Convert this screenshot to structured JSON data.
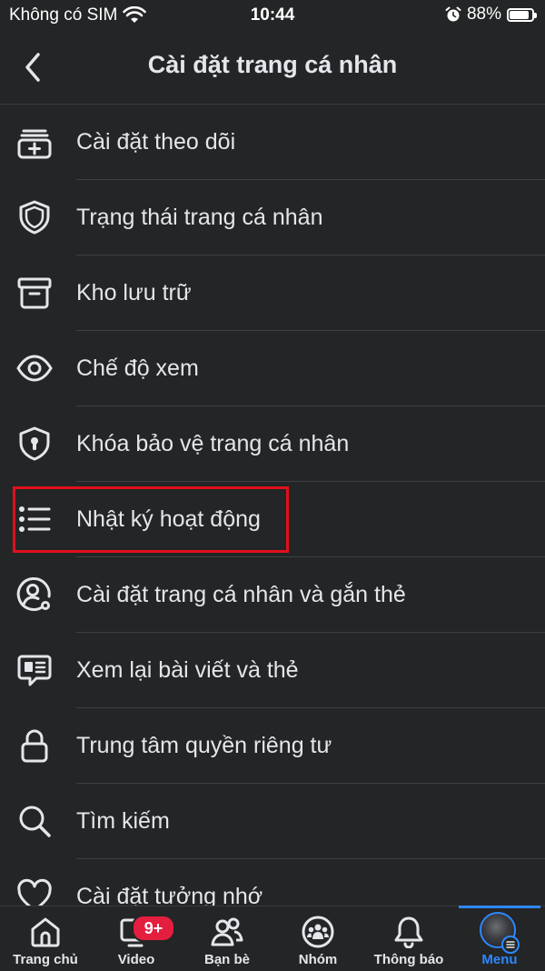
{
  "status_bar": {
    "carrier": "Không có SIM",
    "time": "10:44",
    "battery": "88%",
    "battery_level": 0.88,
    "icons": [
      "wifi-icon",
      "alarm-icon",
      "battery-icon"
    ]
  },
  "header": {
    "title": "Cài đặt trang cá nhân",
    "back_icon": "chevron-left-icon"
  },
  "menu": {
    "items": [
      {
        "label": "Cài đặt theo dõi",
        "icon": "add-follow-icon"
      },
      {
        "label": "Trạng thái trang cá nhân",
        "icon": "shield-icon"
      },
      {
        "label": "Kho lưu trữ",
        "icon": "archive-icon"
      },
      {
        "label": "Chế độ xem",
        "icon": "eye-icon"
      },
      {
        "label": "Khóa bảo vệ trang cá nhân",
        "icon": "shield-lock-icon"
      },
      {
        "label": "Nhật ký hoạt động",
        "icon": "list-icon",
        "highlighted": true
      },
      {
        "label": "Cài đặt trang cá nhân và gắn thẻ",
        "icon": "profile-settings-icon"
      },
      {
        "label": "Xem lại bài viết và thẻ",
        "icon": "review-posts-icon"
      },
      {
        "label": "Trung tâm quyền riêng tư",
        "icon": "lock-icon"
      },
      {
        "label": "Tìm kiếm",
        "icon": "search-icon"
      },
      {
        "label": "Cài đặt tưởng nhớ",
        "icon": "heart-icon"
      }
    ]
  },
  "tab_bar": {
    "tabs": [
      {
        "label": "Trang chủ",
        "icon": "home-icon"
      },
      {
        "label": "Video",
        "icon": "video-icon",
        "badge": "9+"
      },
      {
        "label": "Bạn bè",
        "icon": "friends-icon"
      },
      {
        "label": "Nhóm",
        "icon": "groups-icon"
      },
      {
        "label": "Thông báo",
        "icon": "bell-icon"
      },
      {
        "label": "Menu",
        "icon": "avatar",
        "active": true
      }
    ]
  },
  "colors": {
    "background": "#242526",
    "text": "#e4e6eb",
    "accent": "#2d88ff",
    "badge": "#e41e3f",
    "highlight_box": "#e0101b"
  }
}
